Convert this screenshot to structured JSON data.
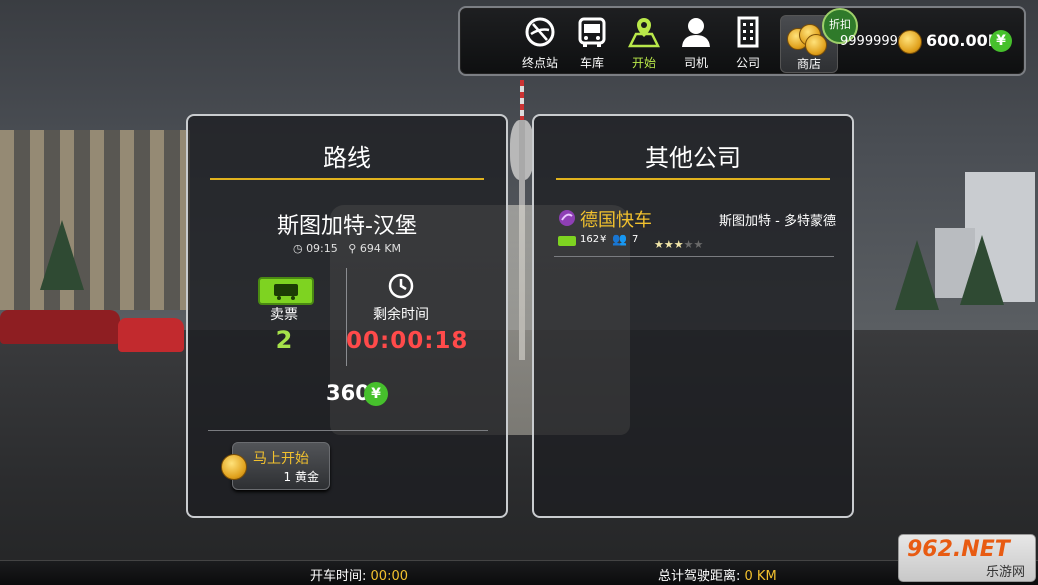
{
  "nav": {
    "terminal": "终点站",
    "garage": "车库",
    "start": "开始",
    "driver": "司机",
    "company": "公司",
    "shop": "商店",
    "sale_badge": "折扣"
  },
  "wallet": {
    "gold": "99999999",
    "money": "600.00M",
    "money_symbol": "¥"
  },
  "route_panel": {
    "title": "路线",
    "route_name": "斯图加特-汉堡",
    "departure_time": "09:15",
    "distance": "694 KM",
    "tickets_label": "卖票",
    "tickets_value": "2",
    "remaining_label": "剩余时间",
    "remaining_value": "00:00:18",
    "price": "360",
    "price_symbol": "¥",
    "start_now_label": "马上开始",
    "start_now_cost": "1 黄金"
  },
  "company_panel": {
    "title": "其他公司",
    "company_name": "德国快车",
    "route": "斯图加特 - 多特蒙德",
    "buses": "162",
    "drivers": "7",
    "rating": 3,
    "rating_max": 5
  },
  "bottom": {
    "drive_time_label": "开车时间:",
    "drive_time_value": "00:00",
    "total_distance_label": "总计驾驶距离:",
    "total_distance_value": "0 KM"
  },
  "watermark": {
    "brand": "962.NET",
    "subtitle": "乐游网"
  },
  "colors": {
    "accent_gold": "#e0b21e",
    "active_green": "#b9e84a",
    "ticket_green": "#7ed321",
    "timer_red": "#ff4a4a",
    "company_name": "#f2c12e"
  }
}
